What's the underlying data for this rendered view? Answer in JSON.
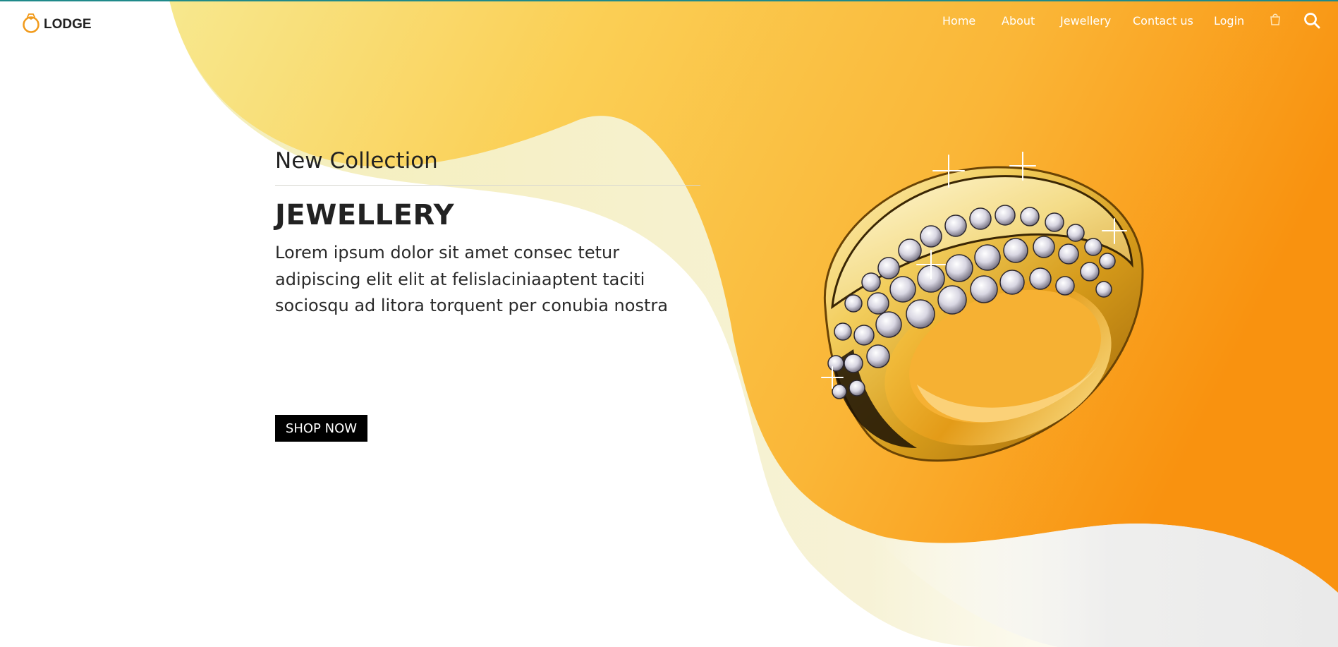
{
  "brand": {
    "name": "LODGE",
    "icon": "ring-logo-icon"
  },
  "nav": {
    "items": [
      {
        "label": "Home"
      },
      {
        "label": "About"
      },
      {
        "label": "Jewellery"
      },
      {
        "label": "Contact us"
      },
      {
        "label": "Login"
      }
    ],
    "cart_icon": "shopping-bag-icon",
    "search_icon": "search-icon"
  },
  "hero": {
    "subtitle": "New Collection",
    "title": "JEWELLERY",
    "text": "Lorem ipsum dolor sit amet consec tetur adipiscing elit elit at felislaciniaaptent taciti sociosqu ad litora torquent per conubia nostra",
    "button_label": "SHOP NOW",
    "image": "diamond-gold-ring-image"
  },
  "colors": {
    "accent_orange": "#f8961a",
    "accent_yellow": "#f4e38c",
    "text_dark": "#222222",
    "button_bg": "#000000"
  }
}
